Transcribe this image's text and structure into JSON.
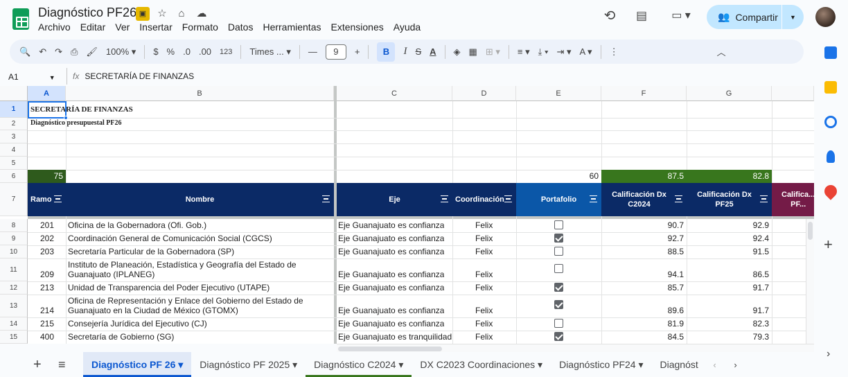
{
  "app": {
    "title": "Diagnóstico PF26",
    "menu": [
      "Archivo",
      "Editar",
      "Ver",
      "Insertar",
      "Formato",
      "Datos",
      "Herramientas",
      "Extensiones",
      "Ayuda"
    ],
    "share_label": "Compartir"
  },
  "toolbar": {
    "zoom": "100%",
    "currency": "$",
    "percent": "%",
    "dec_decrease": ".0",
    "dec_increase": ".00",
    "number_format": "123",
    "font": "Times ...",
    "font_size": "9"
  },
  "formula_bar": {
    "name_box": "A1",
    "fx": "fx",
    "value": "SECRETARÍA DE FINANZAS"
  },
  "columns": [
    "A",
    "B",
    "C",
    "D",
    "E",
    "F",
    "G"
  ],
  "rows": [
    "1",
    "2",
    "3",
    "4",
    "5",
    "6",
    "7",
    "8",
    "9",
    "10",
    "11",
    "12",
    "13",
    "14",
    "15"
  ],
  "sheet": {
    "title": "SECRETARÍA DE FINANZAS",
    "subtitle": "Diagnóstico presupuestal  PF26",
    "summary_a": "75",
    "summary_e": "60",
    "summary_f": "87.5",
    "summary_g": "82.8",
    "headers": {
      "ramo": "Ramo",
      "nombre": "Nombre",
      "eje": "Eje",
      "coord": "Coordinación",
      "portafolio": "Portafolio",
      "cal_c2024": "Calificación Dx C2024",
      "cal_pf25": "Calificación Dx PF25",
      "cal_next": "Califica... PF..."
    },
    "data": [
      {
        "ramo": "201",
        "nombre": "Oficina de la Gobernadora (Ofi. Gob.)",
        "eje": "Eje Guanajuato es confianza",
        "coord": "Felix",
        "portafolio": false,
        "c2024": "90.7",
        "pf25": "92.9"
      },
      {
        "ramo": "202",
        "nombre": "Coordinación General de Comunicación Social (CGCS)",
        "eje": "Eje Guanajuato es confianza",
        "coord": "Felix",
        "portafolio": true,
        "c2024": "92.7",
        "pf25": "92.4"
      },
      {
        "ramo": "203",
        "nombre": "Secretaría Particular de la Gobernadora (SP)",
        "eje": "Eje Guanajuato es confianza",
        "coord": "Felix",
        "portafolio": false,
        "c2024": "88.5",
        "pf25": "91.5"
      },
      {
        "ramo": "209",
        "nombre1": "Instituto de Planeación, Estadística y Geografía del Estado de",
        "nombre2": "Guanajuato (IPLANEG)",
        "eje": "Eje Guanajuato es confianza",
        "coord": "Felix",
        "portafolio": false,
        "c2024": "94.1",
        "pf25": "86.5"
      },
      {
        "ramo": "213",
        "nombre": "Unidad de Transparencia del Poder Ejecutivo (UTAPE)",
        "eje": "Eje Guanajuato es confianza",
        "coord": "Felix",
        "portafolio": true,
        "c2024": "85.7",
        "pf25": "91.7"
      },
      {
        "ramo": "214",
        "nombre1": "Oficina de Representación y Enlace del Gobierno del Estado de",
        "nombre2": "Guanajuato en la Ciudad de México (GTOMX)",
        "eje": "Eje Guanajuato es confianza",
        "coord": "Felix",
        "portafolio": true,
        "c2024": "89.6",
        "pf25": "91.7"
      },
      {
        "ramo": "215",
        "nombre": "Consejería Jurídica del Ejecutivo (CJ)",
        "eje": "Eje Guanajuato es confianza",
        "coord": "Felix",
        "portafolio": false,
        "c2024": "81.9",
        "pf25": "82.3"
      },
      {
        "ramo": "400",
        "nombre": "Secretaría de Gobierno (SG)",
        "eje": "Eje Guanajuato es tranquilidad",
        "coord": "Felix",
        "portafolio": true,
        "c2024": "84.5",
        "pf25": "79.3"
      }
    ]
  },
  "tabs": [
    "Diagnóstico PF 26",
    "Diagnóstico PF 2025",
    "Diagnóstico C2024",
    "DX C2023 Coordinaciones",
    "Diagnóstico PF24",
    "Diagnóst"
  ],
  "colors": {
    "navy": "#0b2a66",
    "green_dark": "#2e5a1c",
    "green": "#38761d",
    "maroon": "#741b47",
    "share_bg": "#c2e7ff"
  }
}
